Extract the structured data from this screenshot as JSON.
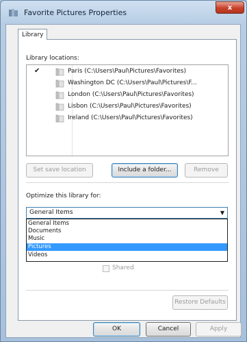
{
  "window": {
    "title": "Favorite Pictures Properties",
    "close_glyph": "x"
  },
  "tabs": [
    {
      "label": "Library"
    }
  ],
  "library": {
    "locations_label": "Library locations:",
    "items": [
      {
        "checked": true,
        "text": "Paris (C:\\Users\\Paul\\Pictures\\Favorites)"
      },
      {
        "checked": false,
        "text": "Washington DC (C:\\Users\\Paul\\Pictures\\F..."
      },
      {
        "checked": false,
        "text": "London (C:\\Users\\Paul\\Pictures\\Favorites)"
      },
      {
        "checked": false,
        "text": "Lisbon (C:\\Users\\Paul\\Pictures\\Favorites)"
      },
      {
        "checked": false,
        "text": "Ireland (C:\\Users\\Paul\\Pictures\\Favorites)"
      }
    ],
    "check_glyph": "✔",
    "set_save_location": "Set save location",
    "include_folder": "Include a folder...",
    "remove": "Remove"
  },
  "optimize": {
    "label": "Optimize this library for:",
    "selected": "General Items",
    "options": [
      "General Items",
      "Documents",
      "Music",
      "Pictures",
      "Videos"
    ],
    "highlighted_index": 3
  },
  "shared_label": "Shared",
  "restore_defaults": "Restore Defaults",
  "footer": {
    "ok": "OK",
    "cancel": "Cancel",
    "apply": "Apply"
  },
  "colors": {
    "highlight": "#3399ff",
    "close": "#c7412a",
    "frame": "#b7cde4"
  }
}
